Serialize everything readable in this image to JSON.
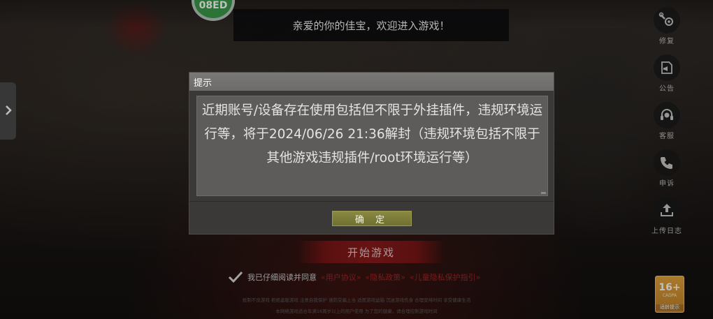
{
  "badge": {
    "text": "08ED"
  },
  "welcome": {
    "text": "亲爱的你的佳宝，欢迎进入游戏！"
  },
  "side_menu": [
    {
      "icon": "gear-wrench-icon",
      "label": "修复"
    },
    {
      "icon": "notice-icon",
      "label": "公告"
    },
    {
      "icon": "headset-icon",
      "label": "客服"
    },
    {
      "icon": "phone-icon",
      "label": "申诉"
    },
    {
      "icon": "upload-icon",
      "label": "上传日志"
    }
  ],
  "start_button": {
    "label": "开始游戏"
  },
  "agreement": {
    "prefix": "我已仔细阅读并同意",
    "link1": "«用户协议»",
    "link2": "«隐私政策»",
    "link3": "«儿童隐私保护指引»"
  },
  "notices": {
    "line1": "抵制不良游戏 拒绝盗版游戏 注意自我保护 谨防受骗上当 适度游戏益脑 沉迷游戏伤身 合理安排时间 享受健康生活",
    "line2": "本网络游戏适合年满16周岁以上的用户使用   为了您的健康，请合理控制游戏时间"
  },
  "age_rating": {
    "number": "16+",
    "sub": "CADPA",
    "label": "适龄提示"
  },
  "dialog": {
    "title": "提示",
    "message": "近期账号/设备存在使用包括但不限于外挂插件，违规环境运行等，将于2024/06/26 21:36解封（违规环境包括不限于其他游戏违规插件/root环境运行等）",
    "confirm": "确 定"
  },
  "colors": {
    "dialog_bg": "#3a3938",
    "confirm_button": "#7b7b3a",
    "start_button": "#8a1a1a",
    "link_red": "#a02727",
    "badge_green": "#3a9a4a"
  }
}
